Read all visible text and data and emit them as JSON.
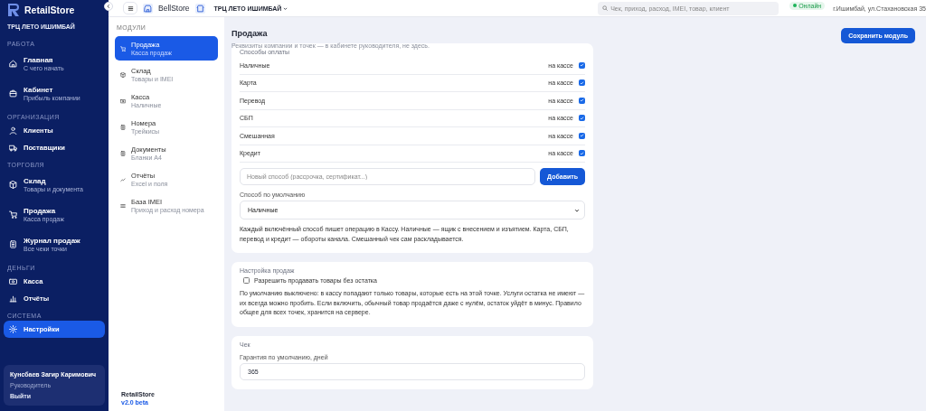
{
  "sidebar": {
    "brand": "RetailStore",
    "store": "ТРЦ ЛЕТО ИШИМБАЙ",
    "sections": [
      {
        "title": "РАБОТА",
        "items": [
          {
            "label": "Главная",
            "sub": "С чего начать",
            "selected": false
          },
          {
            "label": "Кабинет",
            "sub": "Прибыль компании",
            "selected": false
          }
        ]
      },
      {
        "title": "ОРГАНИЗАЦИЯ",
        "items": [
          {
            "label": "Клиенты",
            "selected": false
          },
          {
            "label": "Поставщики",
            "selected": false
          }
        ]
      },
      {
        "title": "ТОРГОВЛЯ",
        "items": [
          {
            "label": "Склад",
            "sub": "Товары и документа",
            "selected": false
          },
          {
            "label": "Продажа",
            "sub": "Касса продаж",
            "selected": false
          },
          {
            "label": "Журнал продаж",
            "sub": "Все чеки точки",
            "selected": false
          }
        ]
      },
      {
        "title": "ДЕНЬГИ",
        "items": [
          {
            "label": "Касса",
            "selected": false
          },
          {
            "label": "Отчёты",
            "selected": false
          }
        ]
      },
      {
        "title": "СИСТЕМА",
        "items": [
          {
            "label": "Настройки",
            "selected": true
          }
        ]
      }
    ],
    "user": {
      "name": "Кунсбаев Загир Каримович",
      "role": "Руководитель",
      "logout": "Выйти"
    }
  },
  "topbar": {
    "company": "BellStore",
    "store": "ТРЦ ЛЕТО ИШИМБАЙ",
    "search": {
      "placeholder": "Чек, приход, расход, IMEI, товар, клиент"
    },
    "status": "Онлайн",
    "address": "г.Ишимбай, ул.Стахановская 35"
  },
  "modules": {
    "title": "МОДУЛИ",
    "items": [
      {
        "label": "Продажа",
        "sub": "Касса продаж",
        "selected": true
      },
      {
        "label": "Склад",
        "sub": "Товары и IMEI",
        "selected": false
      },
      {
        "label": "Касса",
        "sub": "Наличные",
        "selected": false
      },
      {
        "label": "Номера",
        "sub": "Трейкисы",
        "selected": false
      },
      {
        "label": "Документы",
        "sub": "Бланки А4",
        "selected": false
      },
      {
        "label": "Отчёты",
        "sub": "Excel и поля",
        "selected": false
      },
      {
        "label": "База IMEI",
        "sub": "Приход и расход номера",
        "selected": false
      }
    ],
    "footer": {
      "name": "RetailStore",
      "version": "v2.0 beta"
    }
  },
  "main": {
    "title": "Продажа",
    "subtitle": "Реквизиты компании и точек — в кабинете руководителя, не здесь.",
    "save": "Сохранить модуль",
    "payments": {
      "title": "Способы оплаты",
      "methods": [
        {
          "name": "Наличные",
          "tag": "на кассе",
          "checked": true
        },
        {
          "name": "Карта",
          "tag": "на кассе",
          "checked": true
        },
        {
          "name": "Перевод",
          "tag": "на кассе",
          "checked": true
        },
        {
          "name": "СБП",
          "tag": "на кассе",
          "checked": true
        },
        {
          "name": "Смешанная",
          "tag": "на кассе",
          "checked": true
        },
        {
          "name": "Кредит",
          "tag": "на кассе",
          "checked": true
        }
      ],
      "new_placeholder": "Новый способ (рассрочка, сертификат...)",
      "add": "Добавить",
      "default_label": "Способ по умолчанию",
      "default_value": "Наличные",
      "note": "Каждый включённый способ пишет операцию в Кассу. Наличные — ящик с внесением и изъятием. Карта, СБП, перевод и кредит — обороты канала. Смешанный чек сам раскладывается."
    },
    "sales": {
      "title": "Настройка продаж",
      "option": {
        "label": "Разрешить продавать товары без остатка",
        "checked": false
      },
      "note": "По умолчанию выключено: в кассу попадают только товары, которые есть на этой точке. Услуги остатка не имеют — их всегда можно пробить. Если включить, обычный товар продаётся даже с нулём, остаток уйдёт в минус. Правило общее для всех точек, хранится на сервере."
    },
    "receipt": {
      "title": "Чек",
      "warranty_label": "Гарантия по умолчанию, дней",
      "warranty_value": "365"
    }
  }
}
